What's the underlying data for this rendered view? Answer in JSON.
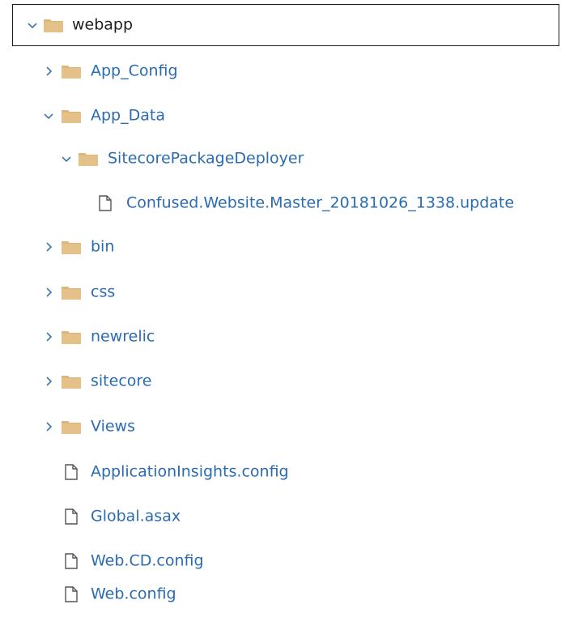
{
  "tree": {
    "root": {
      "label": "webapp",
      "expanded": true
    },
    "items": [
      {
        "label": "App_Config",
        "type": "folder",
        "expanded": false
      },
      {
        "label": "App_Data",
        "type": "folder",
        "expanded": true
      },
      {
        "label": "SitecorePackageDeployer",
        "type": "folder",
        "expanded": true
      },
      {
        "label": "Confused.Website.Master_20181026_1338.update",
        "type": "file"
      },
      {
        "label": "bin",
        "type": "folder",
        "expanded": false
      },
      {
        "label": "css",
        "type": "folder",
        "expanded": false
      },
      {
        "label": "newrelic",
        "type": "folder",
        "expanded": false
      },
      {
        "label": "sitecore",
        "type": "folder",
        "expanded": false
      },
      {
        "label": "Views",
        "type": "folder",
        "expanded": false
      },
      {
        "label": "ApplicationInsights.config",
        "type": "file"
      },
      {
        "label": "Global.asax",
        "type": "file"
      },
      {
        "label": "Web.CD.config",
        "type": "file"
      },
      {
        "label": "Web.config",
        "type": "file"
      }
    ]
  },
  "colors": {
    "label": "#2b6cb0",
    "root_label": "#1f1f1f",
    "folder": "#dcb67a",
    "folder_dark": "#c99a4e",
    "chevron": "#3c78b4",
    "file_outline": "#555555"
  }
}
